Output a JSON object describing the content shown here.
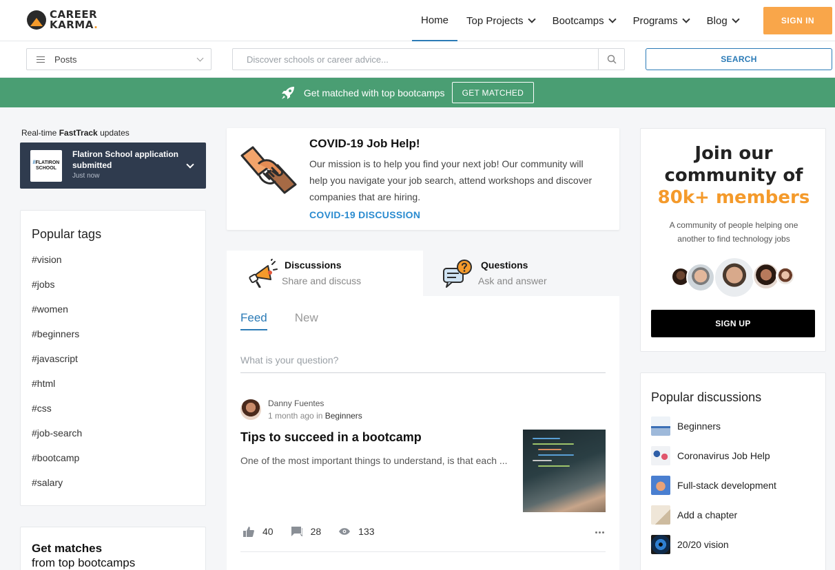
{
  "header": {
    "logo_line1": "CAREER",
    "logo_line2": "KARMA",
    "logo_dot": ".",
    "nav": [
      {
        "label": "Home",
        "active": true,
        "dropdown": false
      },
      {
        "label": "Top Projects",
        "active": false,
        "dropdown": true
      },
      {
        "label": "Bootcamps",
        "active": false,
        "dropdown": true
      },
      {
        "label": "Programs",
        "active": false,
        "dropdown": true
      },
      {
        "label": "Blog",
        "active": false,
        "dropdown": true
      }
    ],
    "signin_label": "SIGN IN"
  },
  "searchbar": {
    "type_select": "Posts",
    "placeholder": "Discover schools or career advice...",
    "search_label": "SEARCH"
  },
  "banner": {
    "text": "Get matched with top bootcamps",
    "button": "GET MATCHED"
  },
  "fasttrack": {
    "label_prefix": "Real-time ",
    "label_bold": "FastTrack",
    "label_suffix": " updates",
    "logo_line1": "FLATIRON",
    "logo_line2": "SCHOOL",
    "title": "Flatiron School application submitted",
    "time": "Just now"
  },
  "popular_tags": {
    "title": "Popular tags",
    "tags": [
      "#vision",
      "#jobs",
      "#women",
      "#beginners",
      "#javascript",
      "#html",
      "#css",
      "#job-search",
      "#bootcamp",
      "#salary"
    ]
  },
  "get_matches": {
    "title": "Get matches",
    "subtitle": "from top bootcamps"
  },
  "covid": {
    "title": "COVID-19 Job Help!",
    "body": "Our mission is to help you find your next job! Our community will help you navigate your job search, attend workshops and discover companies that are hiring.",
    "link": "COVID-19 DISCUSSION"
  },
  "tabs": {
    "discussions": {
      "name": "Discussions",
      "sub": "Share and discuss"
    },
    "questions": {
      "name": "Questions",
      "sub": "Ask and answer"
    }
  },
  "feed": {
    "tabs": [
      "Feed",
      "New"
    ],
    "question_placeholder": "What is your question?"
  },
  "post": {
    "author": "Danny Fuentes",
    "time": "1 month ago",
    "in": "in",
    "category": "Beginners",
    "title": "Tips to succeed in a bootcamp",
    "excerpt": "One of the most important things to understand, is that each ...",
    "likes": "40",
    "comments": "28",
    "views": "133"
  },
  "join": {
    "line1": "Join our",
    "line2": "community of",
    "accent": "80k+ members",
    "subtitle": "A community of people helping one another to find technology jobs",
    "button": "SIGN UP"
  },
  "popular_discussions": {
    "title": "Popular discussions",
    "items": [
      {
        "label": "Beginners",
        "icon": "mountain-thumb"
      },
      {
        "label": "Coronavirus Job Help",
        "icon": "people-thumb"
      },
      {
        "label": "Full-stack development",
        "icon": "hand-thumb"
      },
      {
        "label": "Add a chapter",
        "icon": "book-thumb"
      },
      {
        "label": "20/20 vision",
        "icon": "eye-thumb"
      }
    ]
  },
  "colors": {
    "brand_orange": "#f9a64a",
    "accent_blue": "#2a7ab6",
    "banner_green": "#4a9e73",
    "fasttrack_navy": "#2f3b4e"
  }
}
